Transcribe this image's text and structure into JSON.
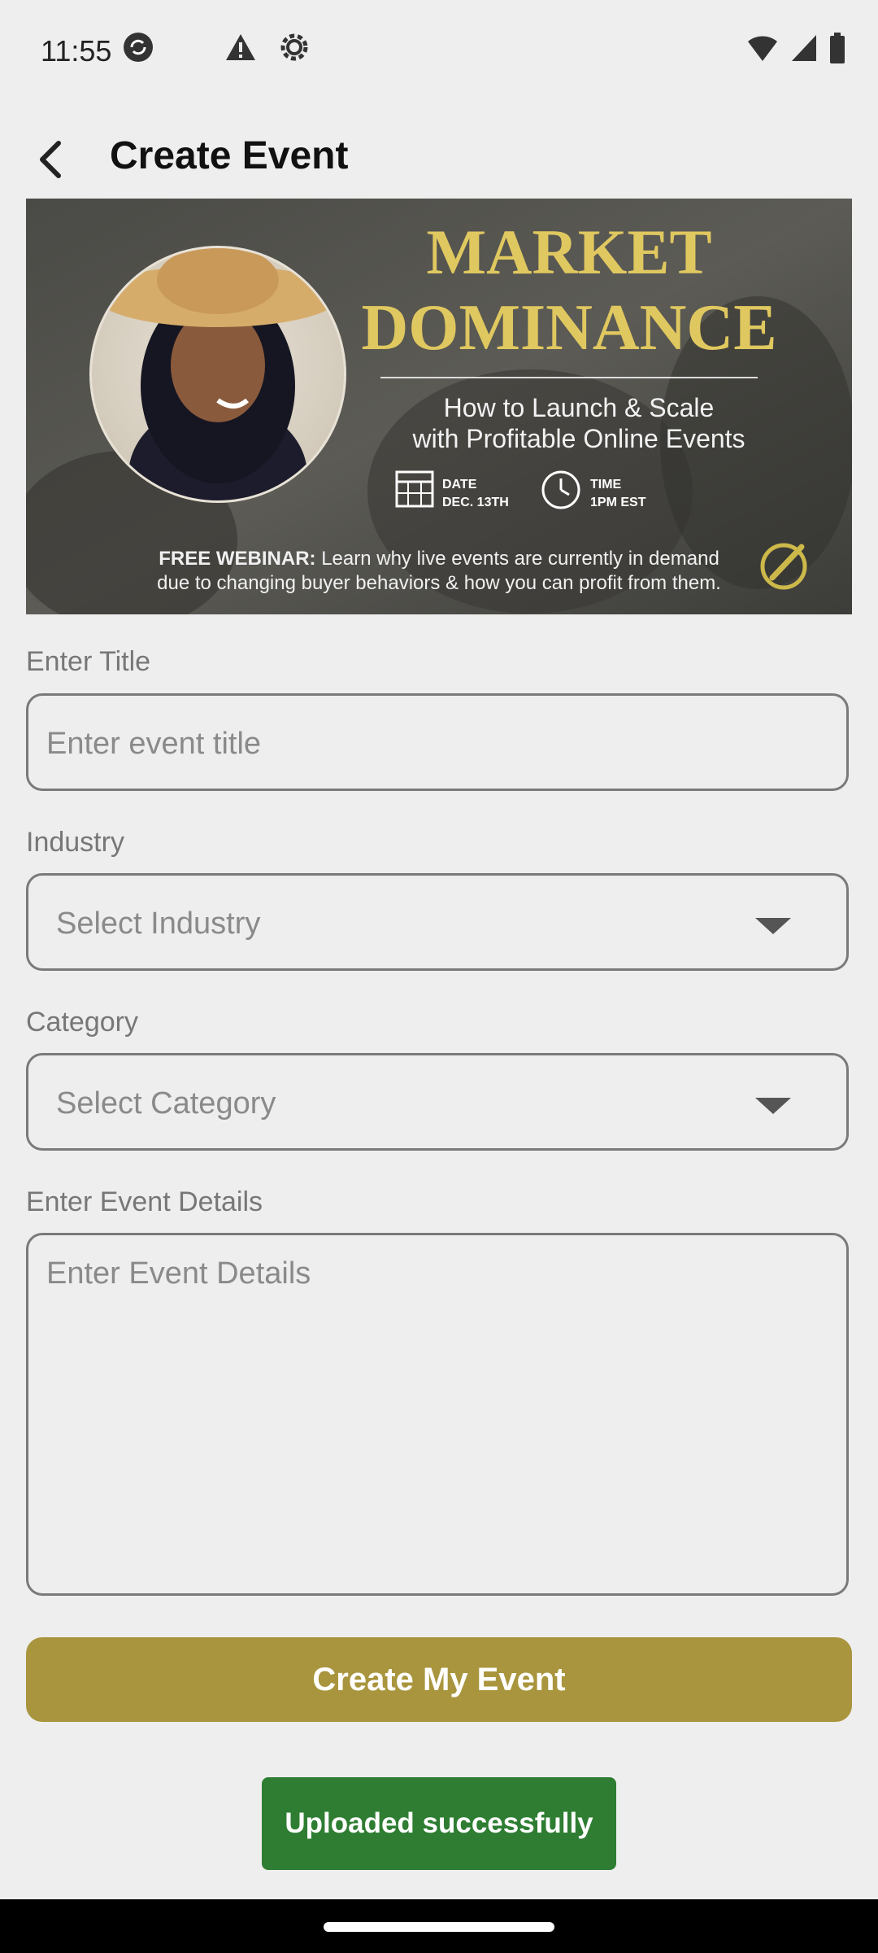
{
  "status_bar": {
    "time": "11:55"
  },
  "header": {
    "title": "Create Event"
  },
  "banner": {
    "title_line1": "MARKET",
    "title_line2": "DOMINANCE",
    "subtitle_line1": "How to Launch & Scale",
    "subtitle_line2": "with Profitable Online Events",
    "date_label": "DATE",
    "date_value": "DEC. 13TH",
    "time_label": "TIME",
    "time_value": "1PM EST",
    "webinar_bold": "FREE WEBINAR:",
    "webinar_text1": " Learn why live events are currently in demand",
    "webinar_text2": "due to changing buyer behaviors & how you can profit from them."
  },
  "form": {
    "title_label": "Enter Title",
    "title_placeholder": "Enter event title",
    "industry_label": "Industry",
    "industry_placeholder": "Select Industry",
    "category_label": "Category",
    "category_placeholder": "Select Category",
    "details_label": "Enter Event Details",
    "details_placeholder": "Enter Event Details"
  },
  "actions": {
    "create_label": "Create My Event"
  },
  "toast": {
    "message": "Uploaded successfully"
  },
  "colors": {
    "accent": "#a9953d",
    "toast": "#2e7d32",
    "background": "#eeeeee"
  }
}
